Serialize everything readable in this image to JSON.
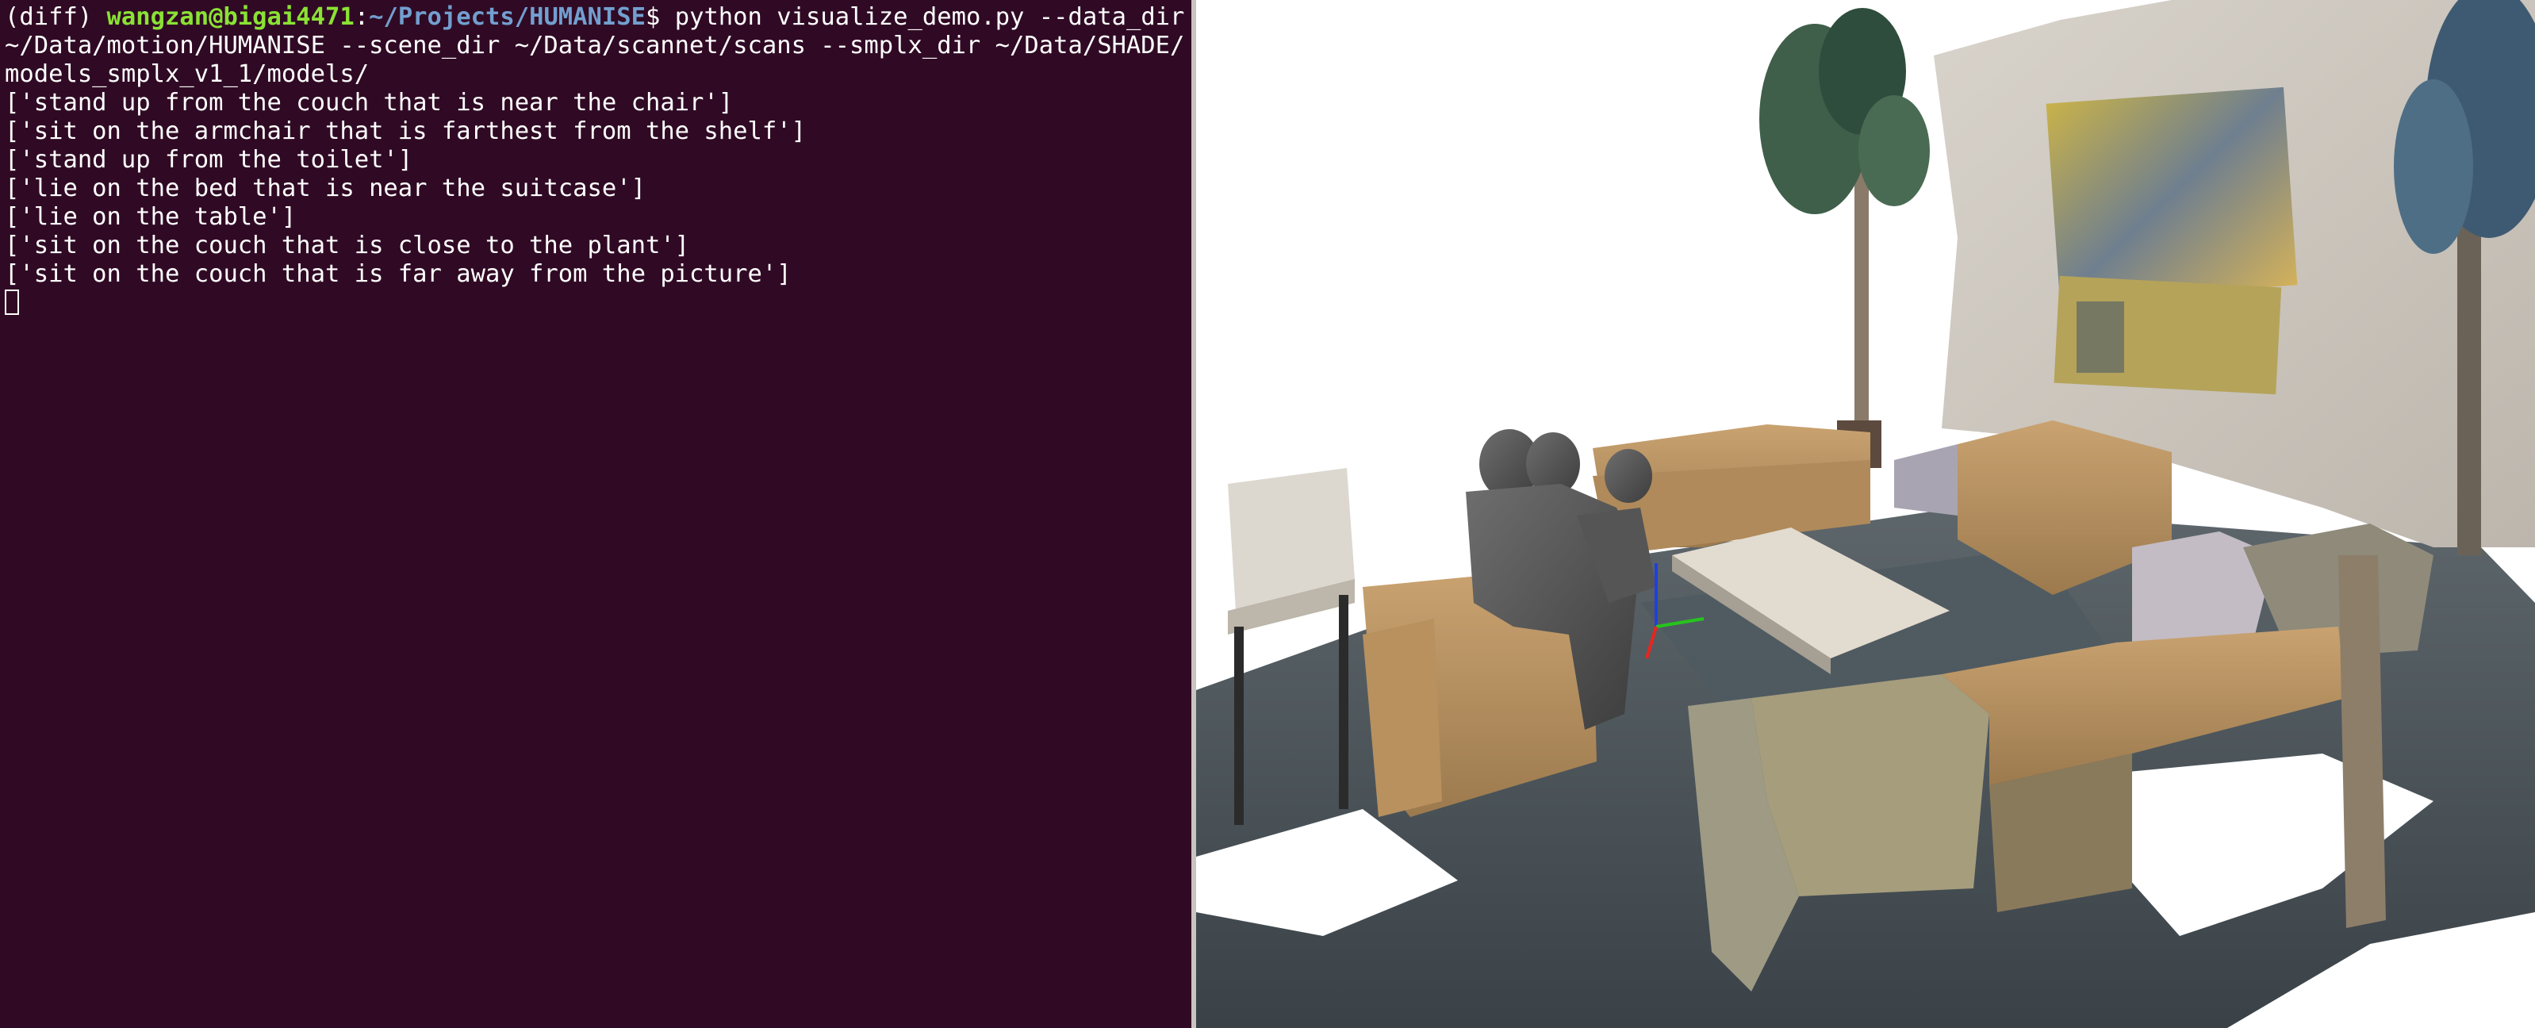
{
  "terminal": {
    "prompt": {
      "env": "(diff) ",
      "user_host": "wangzan@bigai4471",
      "separator": ":",
      "path": "~/Projects/HUMANISE",
      "symbol": "$ "
    },
    "command": "python visualize_demo.py --data_dir ~/Data/motion/HUMANISE --scene_dir ~/Data/scannet/scans --smplx_dir ~/Data/SHADE/models_smplx_v1_1/models/",
    "output_lines": [
      "['stand up from the couch that is near the chair']",
      "['sit on the armchair that is farthest from the shelf']",
      "['stand up from the toilet']",
      "['lie on the bed that is near the suitcase']",
      "['lie on the table']",
      "['sit on the couch that is close to the plant']",
      "['sit on the couch that is far away from the picture']"
    ],
    "colors": {
      "background": "#300a24",
      "text": "#ffffff",
      "user_host": "#8ae234",
      "path": "#729fcf"
    }
  },
  "viewer": {
    "background": "#ffffff",
    "axes_colors": {
      "x": "#e8261e",
      "y": "#27c41d",
      "z": "#1f3fe0"
    }
  }
}
